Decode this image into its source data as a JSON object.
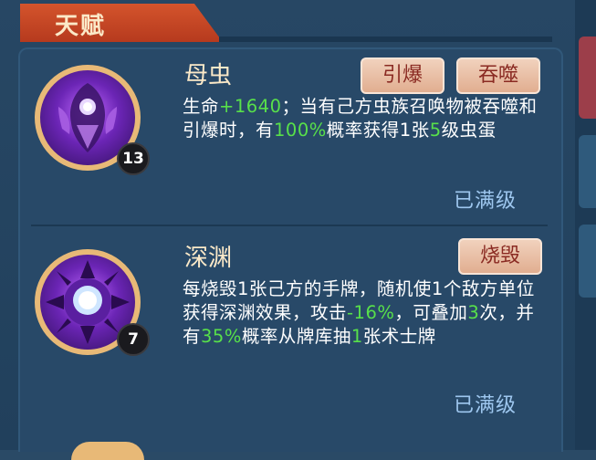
{
  "panel": {
    "title": "天赋"
  },
  "talents": [
    {
      "name": "母虫",
      "level": "13",
      "buttons": [
        "引爆",
        "吞噬"
      ],
      "desc_segments": [
        {
          "t": "生命",
          "hl": false
        },
        {
          "t": "+1640",
          "hl": true
        },
        {
          "t": "；当有己方虫族召唤物被吞噬和引爆时，有",
          "hl": false
        },
        {
          "t": "100%",
          "hl": true
        },
        {
          "t": "概率获得1张",
          "hl": false
        },
        {
          "t": "5",
          "hl": true
        },
        {
          "t": "级虫蛋",
          "hl": false
        }
      ],
      "status": "已满级",
      "icon": "mother-bug-icon"
    },
    {
      "name": "深渊",
      "level": "7",
      "buttons": [
        "烧毁"
      ],
      "desc_segments": [
        {
          "t": "每烧毁1张己方的手牌，随机使1个敌方单位获得深渊效果，攻击",
          "hl": false
        },
        {
          "t": "-16%",
          "hl": true
        },
        {
          "t": "，可叠加",
          "hl": false
        },
        {
          "t": "3",
          "hl": true
        },
        {
          "t": "次，并有",
          "hl": false
        },
        {
          "t": "35%",
          "hl": true
        },
        {
          "t": "概率从牌库抽",
          "hl": false
        },
        {
          "t": "1",
          "hl": true
        },
        {
          "t": "张术士牌",
          "hl": false
        }
      ],
      "status": "已满级",
      "icon": "abyss-orb-icon"
    }
  ],
  "colors": {
    "highlight": "#58e04a",
    "title_bar": "#c8462a",
    "button_text": "#8a2a22",
    "status_text": "#9ec7ef"
  }
}
